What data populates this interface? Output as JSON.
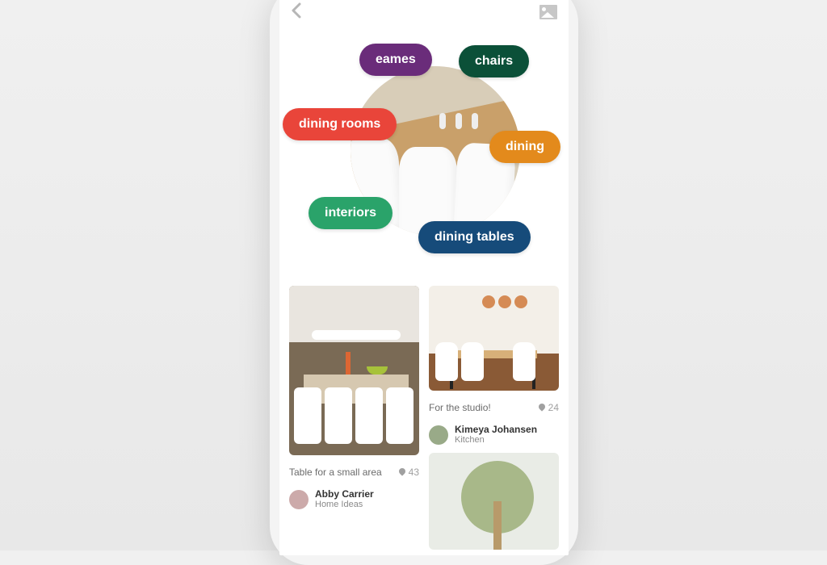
{
  "hero": {
    "tags": {
      "eames": "eames",
      "chairs": "chairs",
      "dining_rooms": "dining rooms",
      "dining": "dining",
      "interiors": "interiors",
      "dining_tables": "dining tables"
    }
  },
  "feed": {
    "left": {
      "pin1": {
        "caption": "Table for a small area",
        "pins": "43",
        "user": "Abby Carrier",
        "board": "Home Ideas"
      }
    },
    "right": {
      "pin1": {
        "caption": "For the studio!",
        "pins": "24",
        "user": "Kimeya Johansen",
        "board": "Kitchen"
      }
    }
  }
}
